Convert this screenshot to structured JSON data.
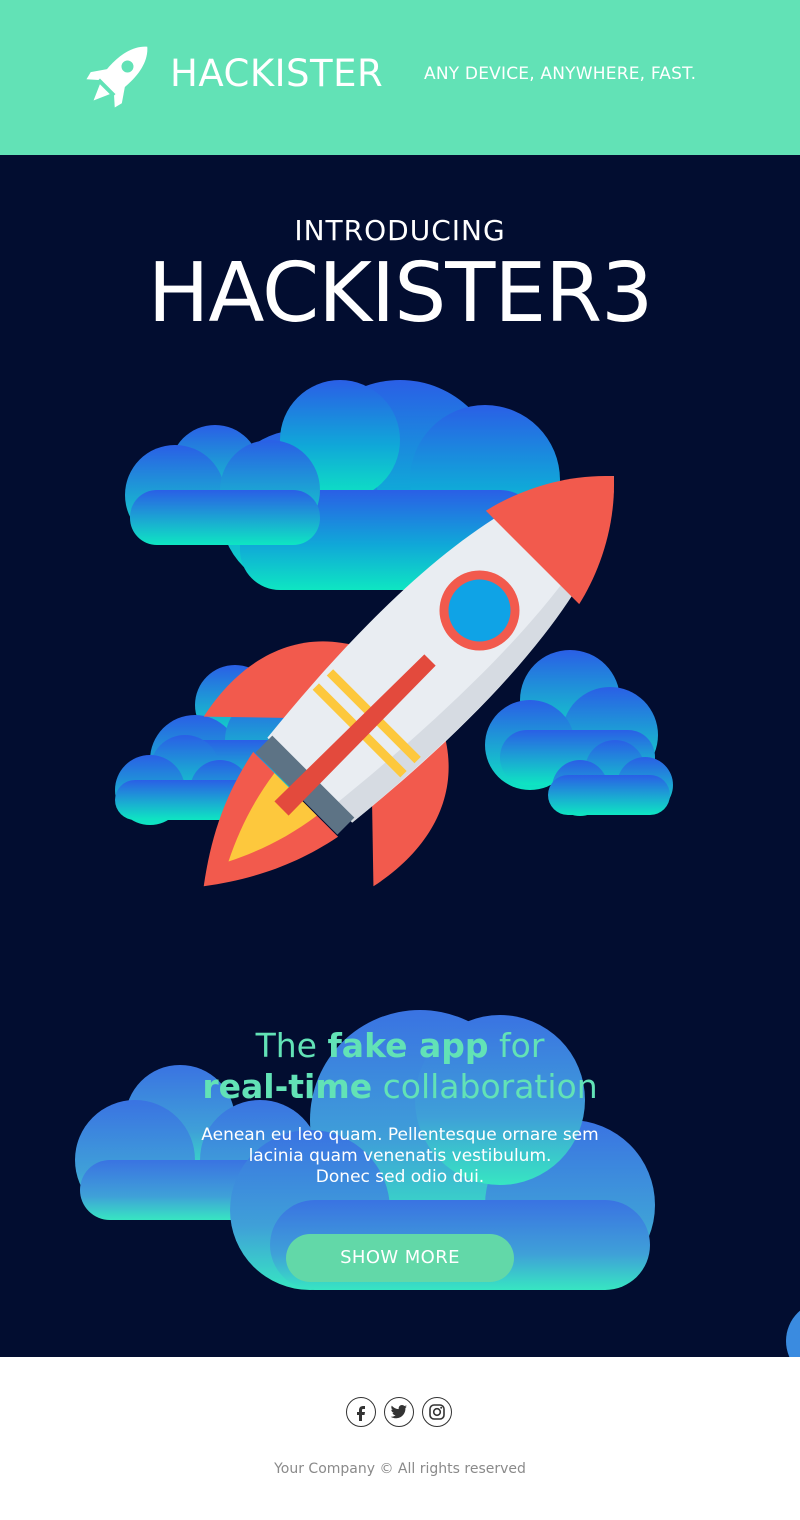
{
  "header": {
    "brand": "HACKISTER",
    "tagline": "ANY DEVICE, ANYWHERE, FAST.",
    "logo_icon": "rocket-icon",
    "background_color": "#62e2b6"
  },
  "hero": {
    "kicker": "INTRODUCING",
    "product": "HACKISTER3",
    "illustration": "rocket-launch-illustration",
    "background_color": "#020d30"
  },
  "cta": {
    "headline_prefix": "The ",
    "headline_bold_1": "fake app",
    "headline_mid": " for",
    "headline_bold_2": "real-time",
    "headline_suffix": " collaboration",
    "body_line_1": "Aenean eu leo quam. Pellentesque ornare sem",
    "body_line_2": "lacinia quam venenatis vestibulum.",
    "body_line_3": "Donec sed odio dui.",
    "button_label": "SHOW MORE",
    "accent_color": "#62e2b6"
  },
  "footer": {
    "social": [
      {
        "icon": "facebook-icon"
      },
      {
        "icon": "twitter-icon"
      },
      {
        "icon": "instagram-icon"
      }
    ],
    "copyright": "Your Company © All rights reserved"
  }
}
